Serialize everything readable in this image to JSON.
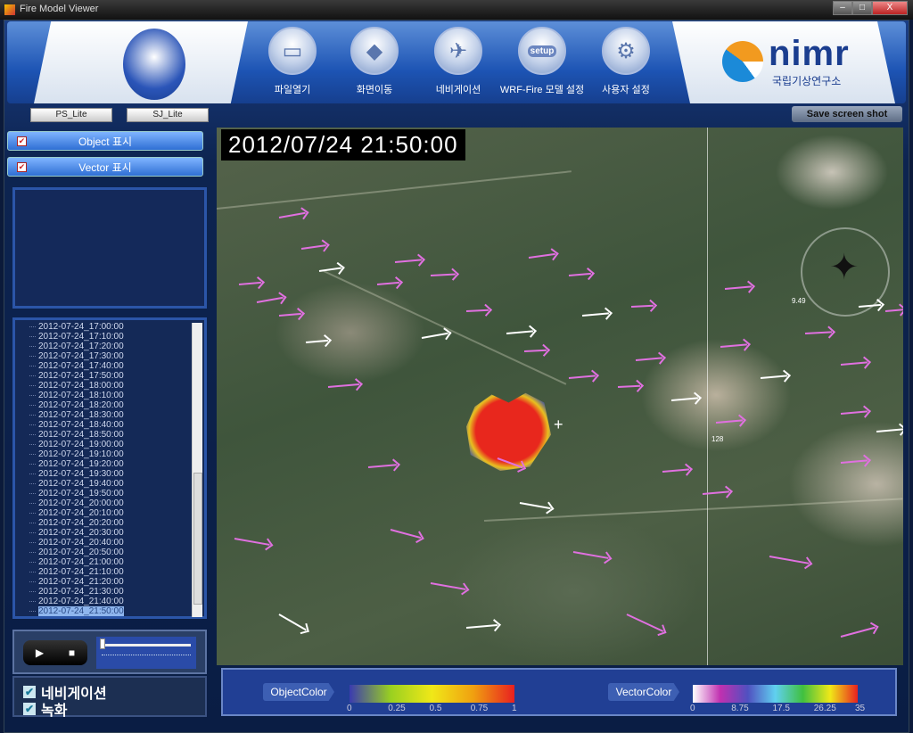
{
  "window": {
    "title": "Fire Model Viewer",
    "controls": [
      "minimize",
      "maximize",
      "close"
    ]
  },
  "header": {
    "tools": [
      {
        "label": "파일열기",
        "icon": "folder-icon"
      },
      {
        "label": "화면이동",
        "icon": "map-move-icon"
      },
      {
        "label": "네비게이션",
        "icon": "navigation-icon"
      },
      {
        "label": "WRF-Fire 모델 설정",
        "icon": "setup-fire-icon",
        "icon_text": "setup"
      },
      {
        "label": "사용자 설정",
        "icon": "gear-icon"
      }
    ],
    "logo_right": {
      "name": "nimr",
      "subtitle": "국립기상연구소"
    }
  },
  "toolbar": {
    "ps_lite": "PS_Lite",
    "sj_lite": "SJ_Lite",
    "save_screenshot": "Save screen shot"
  },
  "left": {
    "object_toggle": {
      "label": "Object 표시",
      "checked": true
    },
    "vector_toggle": {
      "label": "Vector 표시",
      "checked": true
    },
    "times": [
      "2012-07-24_17:00:00",
      "2012-07-24_17:10:00",
      "2012-07-24_17:20:00",
      "2012-07-24_17:30:00",
      "2012-07-24_17:40:00",
      "2012-07-24_17:50:00",
      "2012-07-24_18:00:00",
      "2012-07-24_18:10:00",
      "2012-07-24_18:20:00",
      "2012-07-24_18:30:00",
      "2012-07-24_18:40:00",
      "2012-07-24_18:50:00",
      "2012-07-24_19:00:00",
      "2012-07-24_19:10:00",
      "2012-07-24_19:20:00",
      "2012-07-24_19:30:00",
      "2012-07-24_19:40:00",
      "2012-07-24_19:50:00",
      "2012-07-24_20:00:00",
      "2012-07-24_20:10:00",
      "2012-07-24_20:20:00",
      "2012-07-24_20:30:00",
      "2012-07-24_20:40:00",
      "2012-07-24_20:50:00",
      "2012-07-24_21:00:00",
      "2012-07-24_21:10:00",
      "2012-07-24_21:20:00",
      "2012-07-24_21:30:00",
      "2012-07-24_21:40:00",
      "2012-07-24_21:50:00"
    ],
    "selected_time": "2012-07-24_21:50:00",
    "playback": {
      "play": "▶",
      "stop": "■",
      "slider_position": 0
    },
    "navigation_check": {
      "label": "네비게이션",
      "checked": true
    },
    "record_check": {
      "label": "녹화",
      "checked": true
    }
  },
  "map": {
    "timestamp": "2012/07/24 21:50:00",
    "compass_value": "9.49",
    "marker_label": "128"
  },
  "legend": {
    "object": {
      "label": "ObjectColor",
      "ticks": [
        "0",
        "0.25",
        "0.5",
        "0.75",
        "1"
      ],
      "colors": [
        "#3b3bb0",
        "#9ad020",
        "#f0e818",
        "#f0a010",
        "#e82020"
      ]
    },
    "vector": {
      "label": "VectorColor",
      "ticks": [
        "0",
        "8.75",
        "17.5",
        "26.25",
        "35"
      ],
      "colors": [
        "#ffffff",
        "#c030b0",
        "#5050c0",
        "#60d0f0",
        "#40c040",
        "#f0e818",
        "#e82020"
      ]
    }
  },
  "colors": {
    "vector_arrow_pink": "#e070e0",
    "vector_arrow_white": "#ffffff",
    "fire": "#e8271d"
  }
}
